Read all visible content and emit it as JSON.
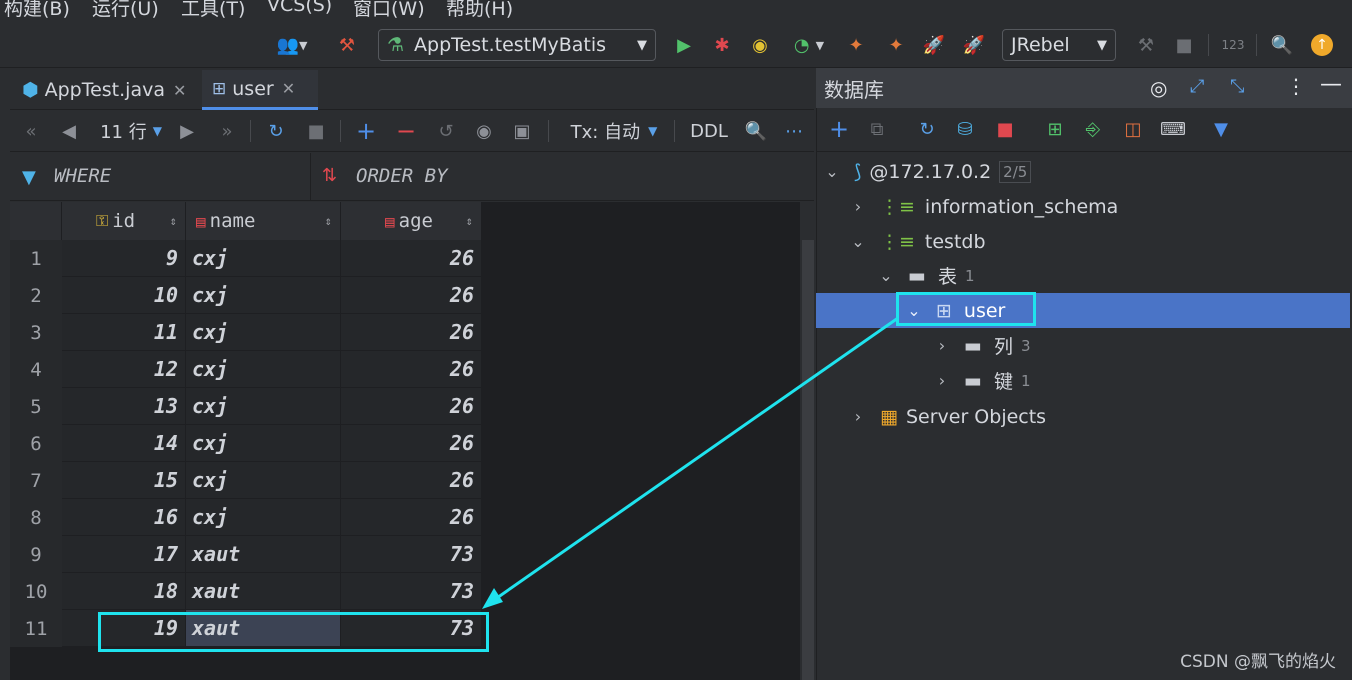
{
  "menu": [
    "构建(B)",
    "运行(U)",
    "工具(T)",
    "VCS(S)",
    "窗口(W)",
    "帮助(H)"
  ],
  "toolbar": {
    "run_config": "AppTest.testMyBatis",
    "jrebel": "JRebel",
    "counter_label": "123"
  },
  "tabs": [
    {
      "label": "AppTest.java"
    },
    {
      "label": "user"
    }
  ],
  "grid_toolbar": {
    "rows_label": "11 行",
    "tx_label": "Tx: 自动",
    "ddl_label": "DDL"
  },
  "filter": {
    "where": "WHERE",
    "order_by": "ORDER BY"
  },
  "table": {
    "columns": [
      "id",
      "name",
      "age"
    ],
    "rows": [
      {
        "n": "1",
        "id": "9",
        "name": "cxj",
        "age": "26"
      },
      {
        "n": "2",
        "id": "10",
        "name": "cxj",
        "age": "26"
      },
      {
        "n": "3",
        "id": "11",
        "name": "cxj",
        "age": "26"
      },
      {
        "n": "4",
        "id": "12",
        "name": "cxj",
        "age": "26"
      },
      {
        "n": "5",
        "id": "13",
        "name": "cxj",
        "age": "26"
      },
      {
        "n": "6",
        "id": "14",
        "name": "cxj",
        "age": "26"
      },
      {
        "n": "7",
        "id": "15",
        "name": "cxj",
        "age": "26"
      },
      {
        "n": "8",
        "id": "16",
        "name": "cxj",
        "age": "26"
      },
      {
        "n": "9",
        "id": "17",
        "name": "xaut",
        "age": "73"
      },
      {
        "n": "10",
        "id": "18",
        "name": "xaut",
        "age": "73"
      },
      {
        "n": "11",
        "id": "19",
        "name": "xaut",
        "age": "73"
      }
    ]
  },
  "database": {
    "title": "数据库",
    "connection": "@172.17.0.2",
    "connection_badge": "2/5",
    "schemas": [
      "information_schema",
      "testdb"
    ],
    "tables_folder": "表",
    "tables_count": "1",
    "table_name": "user",
    "columns_folder": "列",
    "columns_count": "3",
    "keys_folder": "键",
    "keys_count": "1",
    "server_objects": "Server Objects"
  },
  "colors": {
    "accent": "#4f8ee8",
    "selection": "#4a74c7",
    "highlight": "#1fe3ee"
  },
  "watermark": "CSDN @飘飞的焰火"
}
